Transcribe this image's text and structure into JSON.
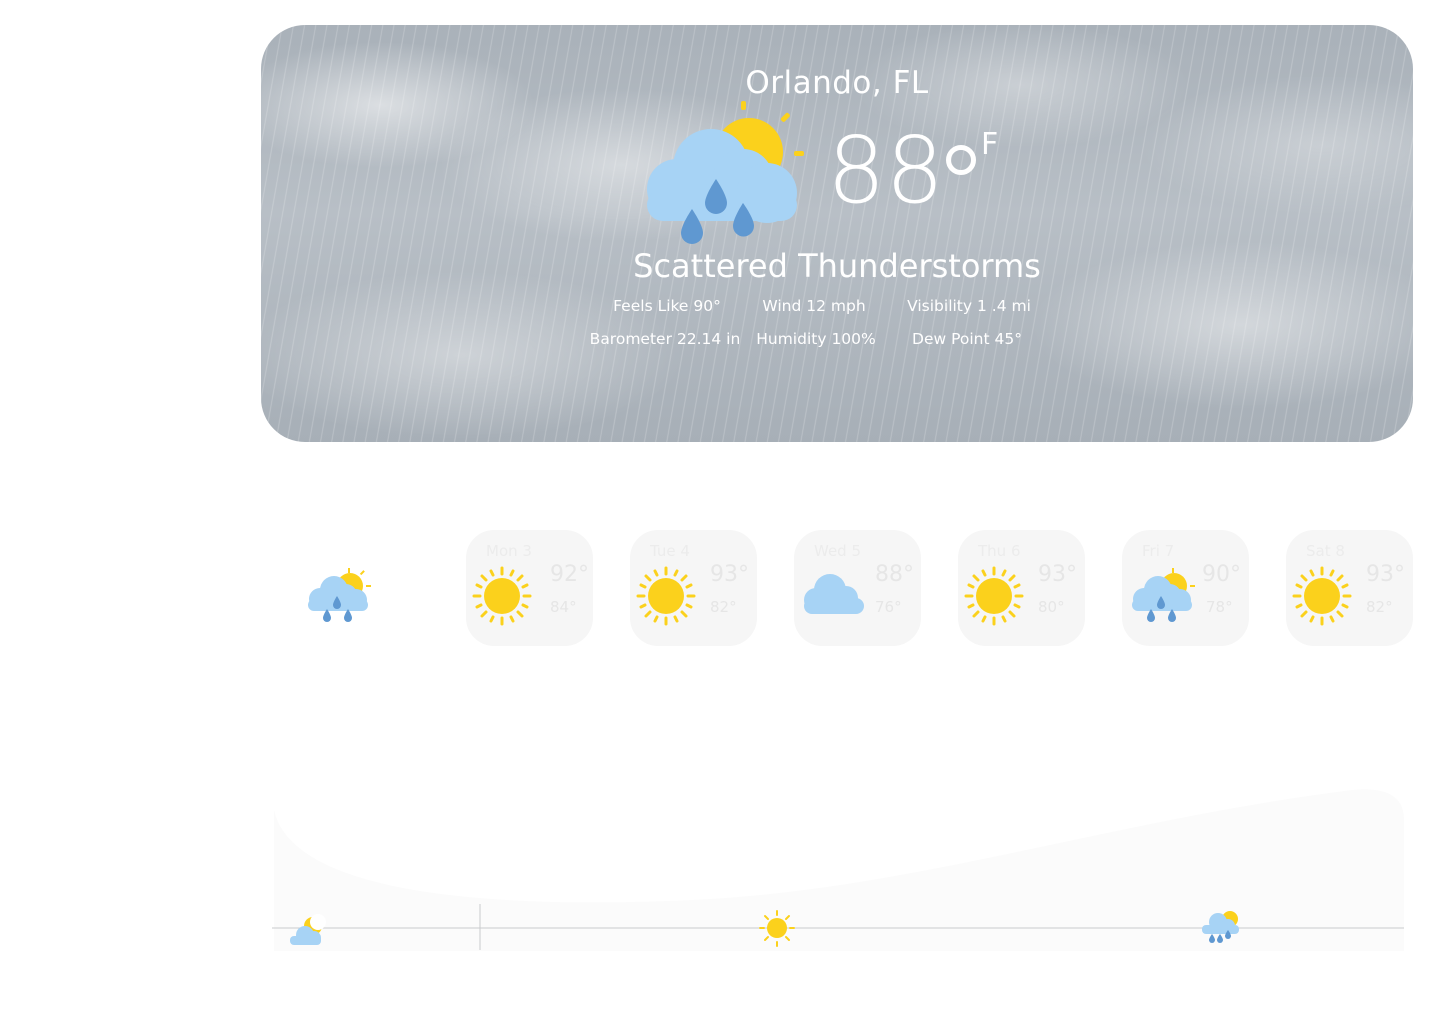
{
  "current": {
    "location": "Orlando, FL",
    "temperature": "88",
    "unit": "F",
    "condition": "Scattered Thunderstorms",
    "icon": "sun-cloud-rain-icon",
    "stats": {
      "feels_like": "Feels Like 90°",
      "wind": "Wind 12 mph",
      "visibility": "Visibility 1 .4 mi",
      "barometer": "Barometer 22.14 in",
      "humidity": "Humidity 100%",
      "dew_point": "Dew Point 45°"
    }
  },
  "today_icon": "sun-cloud-rain-icon",
  "forecast": [
    {
      "day": "Mon 3",
      "high": "92°",
      "low": "84°",
      "icon": "sun-icon"
    },
    {
      "day": "Tue 4",
      "high": "93°",
      "low": "82°",
      "icon": "sun-icon"
    },
    {
      "day": "Wed 5",
      "high": "88°",
      "low": "76°",
      "icon": "cloud-icon"
    },
    {
      "day": "Thu 6",
      "high": "93°",
      "low": "80°",
      "icon": "sun-icon"
    },
    {
      "day": "Fri 7",
      "high": "90°",
      "low": "78°",
      "icon": "sun-cloud-rain-icon"
    },
    {
      "day": "Sat 8",
      "high": "93°",
      "low": "82°",
      "icon": "sun-icon"
    }
  ],
  "hourly_icons": [
    "moon-cloud-icon",
    "sun-icon",
    "sun-cloud-rain-icon"
  ],
  "colors": {
    "sun": "#fbd11c",
    "cloud": "#a7d3f5",
    "drop": "#5f98d1"
  }
}
